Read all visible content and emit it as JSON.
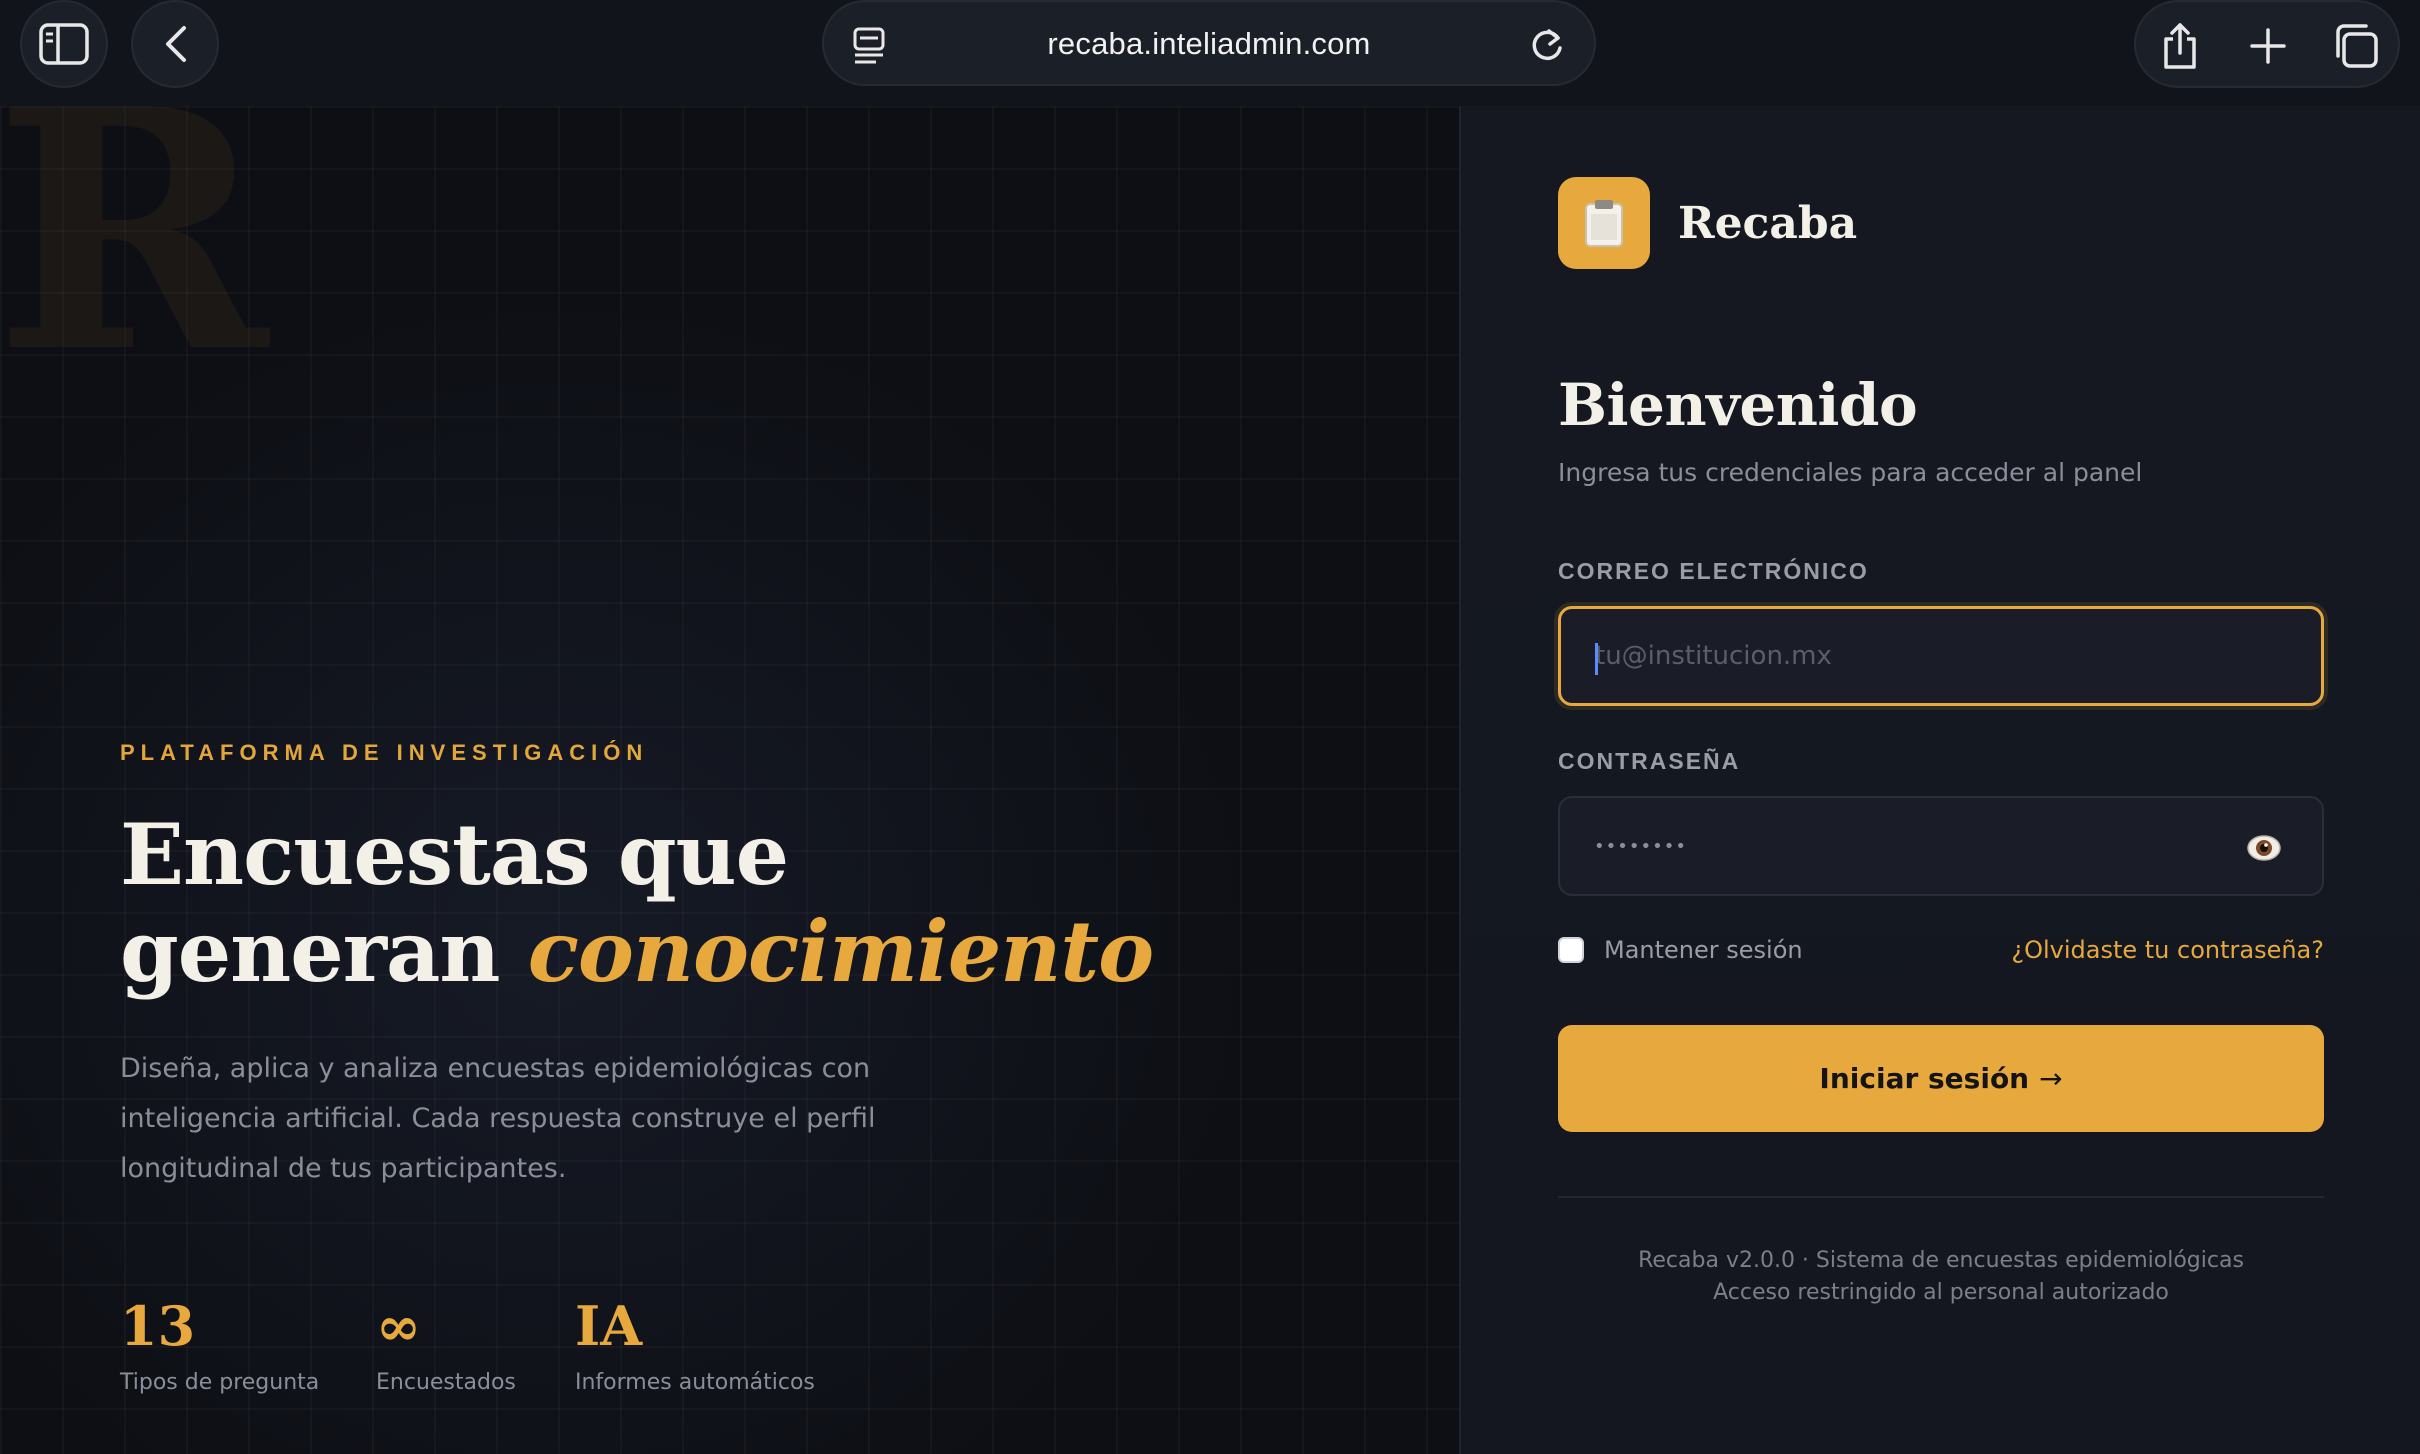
{
  "browser": {
    "url": "recaba.inteliadmin.com",
    "icons": [
      "sidebar-icon",
      "back-icon",
      "reader-icon",
      "reload-icon",
      "share-icon",
      "plus-icon",
      "tabs-icon"
    ]
  },
  "hero": {
    "watermark": "R",
    "eyebrow": "PLATAFORMA DE INVESTIGACIÓN",
    "headline_line1": "Encuestas que",
    "headline_line2_plain": "generan ",
    "headline_line2_accent": "conocimiento",
    "description": "Diseña, aplica y analiza encuestas epidemiológicas con inteligencia artificial. Cada respuesta construye el perfil longitudinal de tus participantes.",
    "stats": [
      {
        "value": "13",
        "label": "Tipos de pregunta"
      },
      {
        "value": "∞",
        "label": "Encuestados"
      },
      {
        "value": "IA",
        "label": "Informes automáticos"
      }
    ]
  },
  "login": {
    "brand_name": "Recaba",
    "brand_icon": "clipboard-icon",
    "title": "Bienvenido",
    "subtitle": "Ingresa tus credenciales para acceder al panel",
    "email_label": "CORREO ELECTRÓNICO",
    "email_placeholder": "tu@institucion.mx",
    "email_value": "",
    "password_label": "CONTRASEÑA",
    "password_masked": "••••••••",
    "remember_label": "Mantener sesión",
    "remember_checked": false,
    "forgot_label": "¿Olvidaste tu contraseña?",
    "submit_label": "Iniciar sesión",
    "submit_arrow": "→",
    "footer_line1": "Recaba v2.0.0 · Sistema de encuestas epidemiológicas",
    "footer_line2": "Acceso restringido al personal autorizado"
  },
  "colors": {
    "accent": "#e7a93d",
    "background": "#0d0f14",
    "panel": "#151821"
  }
}
